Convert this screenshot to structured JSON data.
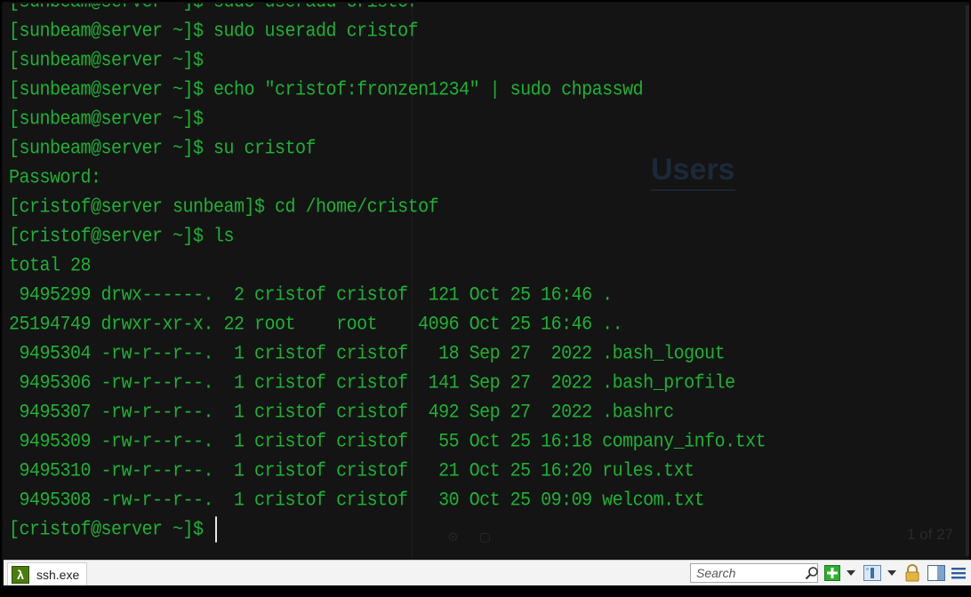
{
  "terminal": {
    "lines": [
      "[sunbeam@server ~]$ sudo useradd cristof",
      "[sunbeam@server ~]$ sudo useradd cristof",
      "[sunbeam@server ~]$",
      "[sunbeam@server ~]$ echo \"cristof:fronzen1234\" | sudo chpasswd",
      "[sunbeam@server ~]$",
      "[sunbeam@server ~]$ su cristof",
      "Password:",
      "[cristof@server sunbeam]$ cd /home/cristof",
      "[cristof@server ~]$ ls",
      "total 28",
      " 9495299 drwx------.  2 cristof cristof  121 Oct 25 16:46 .",
      "25194749 drwxr-xr-x. 22 root    root    4096 Oct 25 16:46 ..",
      " 9495304 -rw-r--r--.  1 cristof cristof   18 Sep 27  2022 .bash_logout",
      " 9495306 -rw-r--r--.  1 cristof cristof  141 Sep 27  2022 .bash_profile",
      " 9495307 -rw-r--r--.  1 cristof cristof  492 Sep 27  2022 .bashrc",
      " 9495309 -rw-r--r--.  1 cristof cristof   55 Oct 25 16:18 company_info.txt",
      " 9495310 -rw-r--r--.  1 cristof cristof   21 Oct 25 16:20 rules.txt",
      " 9495308 -rw-r--r--.  1 cristof cristof   30 Oct 25 09:09 welcom.txt",
      "[cristof@server ~]$"
    ],
    "ghost_title": "Users",
    "ghost_page": "1 of 27",
    "text_color": "#1db233"
  },
  "taskbar": {
    "tab_label": "ssh.exe",
    "tab_icon": "lambda-icon",
    "tab_icon_glyph": "λ",
    "search_placeholder": "Search"
  }
}
